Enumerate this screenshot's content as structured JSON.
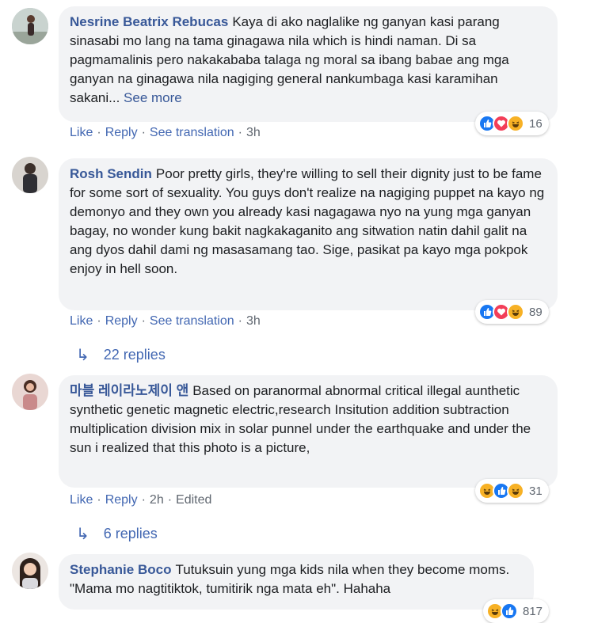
{
  "comments": [
    {
      "author": "Nesrine Beatrix Rebucas",
      "text": "Kaya di ako naglalike ng ganyan kasi parang sinasabi mo lang na tama ginagawa nila which is hindi naman. Di sa pagmamalinis pero nakakababa talaga ng moral sa ibang babae ang mga ganyan na ginagawa nila nagiging general nankumbaga kasi karamihan sakani",
      "ellipsis": "...",
      "see_more": "See more",
      "actions": {
        "like": "Like",
        "reply": "Reply",
        "translate": "See translation",
        "time": "3h"
      },
      "reactions": {
        "icons": [
          "like-icon",
          "love-icon",
          "haha-icon"
        ],
        "count": "16"
      }
    },
    {
      "author": "Rosh Sendin",
      "text": "Poor pretty girls, they're willing to sell their dignity just to be fame for some sort of sexuality. You guys don't realize na nagiging puppet na kayo ng demonyo and they own you already kasi nagagawa nyo na yung mga ganyan bagay, no wonder kung bakit nagkakaganito ang sitwation natin dahil galit na ang dyos dahil dami ng masasamang tao. Sige, pasikat pa kayo mga pokpok enjoy in hell soon.",
      "actions": {
        "like": "Like",
        "reply": "Reply",
        "translate": "See translation",
        "time": "3h"
      },
      "reactions": {
        "icons": [
          "like-icon",
          "love-icon",
          "haha-icon"
        ],
        "count": "89"
      },
      "replies": "22 replies"
    },
    {
      "author": "마블 레이라노제이 앤",
      "text": "Based on paranormal abnormal critical illegal aunthetic synthetic genetic magnetic electric,research Insitution addition subtraction multiplication division mix in solar punnel under the earthquake and under the sun i realized that this photo is a picture,",
      "actions": {
        "like": "Like",
        "reply": "Reply",
        "time": "2h",
        "edited": "Edited"
      },
      "reactions": {
        "icons": [
          "haha-icon",
          "like-icon",
          "haha-icon"
        ],
        "count": "31"
      },
      "replies": "6 replies"
    },
    {
      "author": "Stephanie Boco",
      "text": "Tutuksuin yung mga kids nila when they become moms. \"Mama mo nagtitiktok, tumitirik nga mata eh\". Hahaha",
      "reactions": {
        "icons": [
          "haha-icon",
          "like-icon"
        ],
        "count": "817"
      }
    }
  ],
  "colors": {
    "link": "#385898",
    "action": "#4267b2",
    "bubble": "#f2f3f5"
  }
}
